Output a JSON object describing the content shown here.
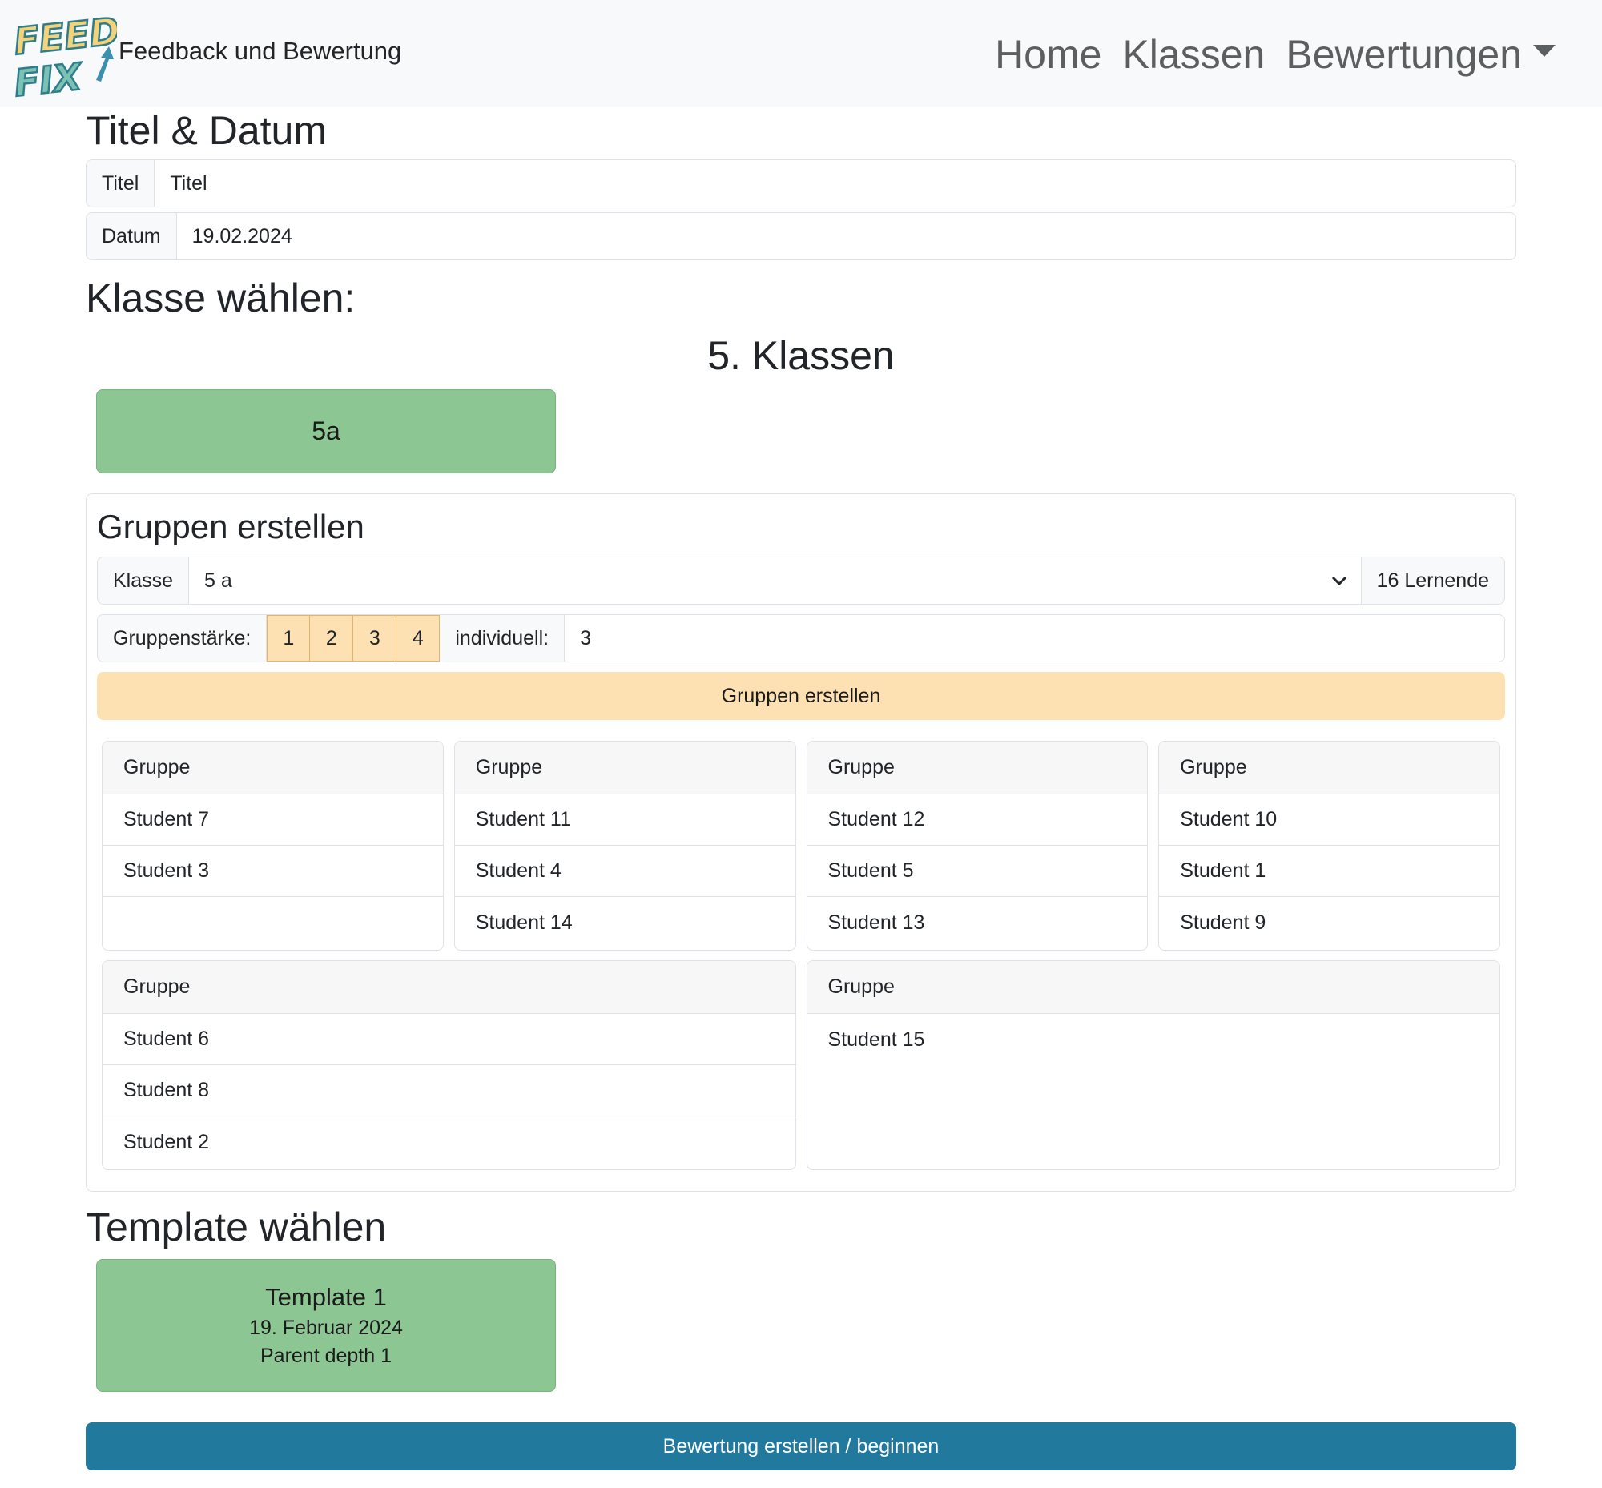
{
  "navbar": {
    "logo_text": [
      "FEED",
      "FIX"
    ],
    "brand": "Feedback und Bewertung",
    "links": [
      "Home",
      "Klassen",
      "Bewertungen"
    ]
  },
  "title_section": {
    "heading": "Titel & Datum",
    "title_label": "Titel",
    "title_value": "Titel",
    "date_label": "Datum",
    "date_value": "19.02.2024"
  },
  "class_section": {
    "heading": "Klasse wählen:",
    "grade_heading": "5. Klassen",
    "classes": [
      "5a"
    ]
  },
  "groups_section": {
    "heading": "Gruppen erstellen",
    "class_label": "Klasse",
    "class_value": "5 a",
    "learner_count": "16 Lernende",
    "size_label": "Gruppenstärke:",
    "size_options": [
      "1",
      "2",
      "3",
      "4"
    ],
    "custom_label": "individuell:",
    "custom_value": "3",
    "create_button": "Gruppen erstellen",
    "groups": [
      {
        "title": "Gruppe",
        "members": [
          "Student 7",
          "Student 3"
        ]
      },
      {
        "title": "Gruppe",
        "members": [
          "Student 11",
          "Student 4",
          "Student 14"
        ]
      },
      {
        "title": "Gruppe",
        "members": [
          "Student 12",
          "Student 5",
          "Student 13"
        ]
      },
      {
        "title": "Gruppe",
        "members": [
          "Student 10",
          "Student 1",
          "Student 9"
        ]
      },
      {
        "title": "Gruppe",
        "members": [
          "Student 6",
          "Student 8",
          "Student 2"
        ]
      },
      {
        "title": "Gruppe",
        "members": [
          "Student 15"
        ]
      }
    ]
  },
  "template_section": {
    "heading": "Template wählen",
    "template": {
      "name": "Template 1",
      "date": "19. Februar 2024",
      "info": "Parent depth 1"
    }
  },
  "submit_button": "Bewertung erstellen / beginnen",
  "colors": {
    "navbar_bg": "#f8f9fa",
    "card_green": "#8cc793",
    "warning_light": "#fee1b2",
    "primary_button": "#217a9e"
  }
}
